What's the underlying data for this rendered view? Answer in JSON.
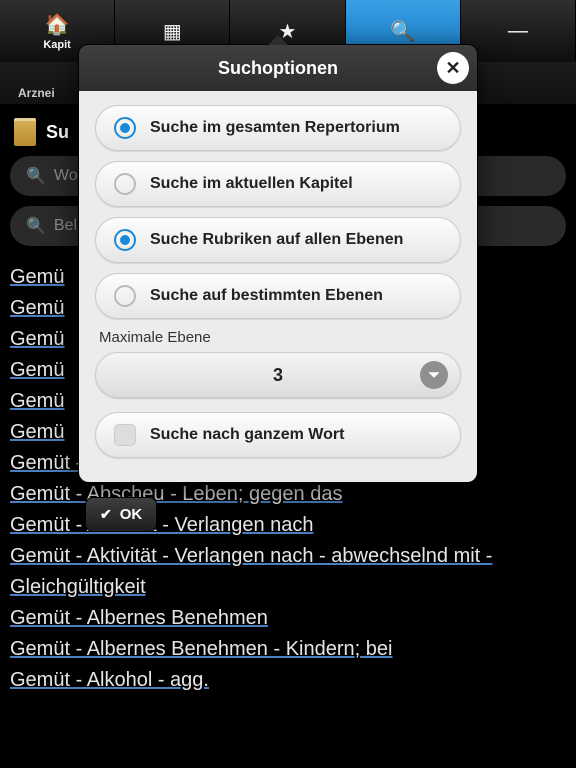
{
  "tabs": {
    "chapter": {
      "icon": "🏠",
      "label": "Kapit"
    },
    "grid": {
      "icon": "▦"
    },
    "star": {
      "icon": "★"
    },
    "search": {
      "icon": "🔍"
    },
    "minus": {
      "icon": "—"
    }
  },
  "subbar": {
    "arzneimittel": "Arznei"
  },
  "section": {
    "title": "Su"
  },
  "inputs": {
    "word_placeholder": "Wo",
    "any_placeholder": "Bel"
  },
  "results": [
    "Gemü",
    "Gemü",
    "Gemü",
    "Gemü",
    "Gemü",
    "Gemü",
    "Gemüt - Abscheu - allgemeiner Abscheu",
    "Gemüt - Abscheu - Leben; gegen das",
    "Gemüt - Aktivität - Verlangen nach",
    "Gemüt - Aktivität - Verlangen nach - abwechselnd mit - Gleichgültigkeit",
    "Gemüt - Albernes Benehmen",
    "Gemüt - Albernes Benehmen - Kindern; bei",
    "Gemüt - Alkohol - agg."
  ],
  "popover": {
    "title": "Suchoptionen",
    "opt_all_repertory": "Suche im gesamten Repertorium",
    "opt_current_chapter": "Suche im aktuellen Kapitel",
    "opt_all_levels": "Suche Rubriken auf allen Ebenen",
    "opt_specific_levels": "Suche auf bestimmten Ebenen",
    "max_level_label": "Maximale Ebene",
    "max_level_value": "3",
    "whole_word": "Suche nach ganzem Wort",
    "ok": "OK"
  }
}
